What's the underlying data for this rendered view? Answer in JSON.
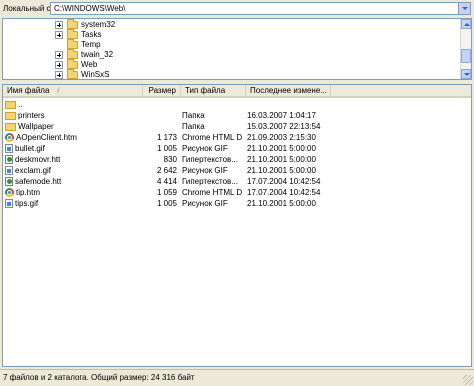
{
  "pathbar": {
    "label": "Локальный сайт:",
    "value": "C:\\WINDOWS\\Web\\"
  },
  "tree": {
    "items": [
      {
        "label": "system32",
        "expandable": true
      },
      {
        "label": "Tasks",
        "expandable": true
      },
      {
        "label": "Temp",
        "expandable": false
      },
      {
        "label": "twain_32",
        "expandable": true
      },
      {
        "label": "Web",
        "expandable": true
      },
      {
        "label": "WinSxS",
        "expandable": true
      }
    ]
  },
  "list": {
    "columns": {
      "name": "Имя файла",
      "size": "Размер",
      "type": "Тип файла",
      "date": "Последнее измене..."
    },
    "sort_indicator": "/",
    "rows": [
      {
        "name": "..",
        "size": "",
        "type": "",
        "date": "",
        "icon": "folder-icon"
      },
      {
        "name": "printers",
        "size": "",
        "type": "Папка",
        "date": "16.03.2007 1:04:17",
        "icon": "folder-icon"
      },
      {
        "name": "Wallpaper",
        "size": "",
        "type": "Папка",
        "date": "15.03.2007 22:13:54",
        "icon": "folder-icon"
      },
      {
        "name": "AOpenClient.htm",
        "size": "1 173",
        "type": "Chrome HTML D...",
        "date": "21.09.2003 2:15:30",
        "icon": "chrome-html-icon"
      },
      {
        "name": "bullet.gif",
        "size": "1 005",
        "type": "Рисунок GIF",
        "date": "21.10.2001 5:00:00",
        "icon": "gif-file-icon"
      },
      {
        "name": "deskmovr.htt",
        "size": "830",
        "type": "Гипертекстов...",
        "date": "21.10.2001 5:00:00",
        "icon": "htt-file-icon"
      },
      {
        "name": "exclam.gif",
        "size": "2 642",
        "type": "Рисунок GIF",
        "date": "21.10.2001 5:00:00",
        "icon": "gif-file-icon"
      },
      {
        "name": "safemode.htt",
        "size": "4 414",
        "type": "Гипертекстов...",
        "date": "17.07.2004 10:42:54",
        "icon": "htt-file-icon"
      },
      {
        "name": "tip.htm",
        "size": "1 059",
        "type": "Chrome HTML D...",
        "date": "17.07.2004 10:42:54",
        "icon": "chrome-html-icon"
      },
      {
        "name": "tips.gif",
        "size": "1 005",
        "type": "Рисунок GIF",
        "date": "21.10.2001 5:00:00",
        "icon": "gif-file-icon"
      }
    ]
  },
  "status": {
    "text": "7 файлов и 2 каталога. Общий размер: 24 316 байт"
  }
}
